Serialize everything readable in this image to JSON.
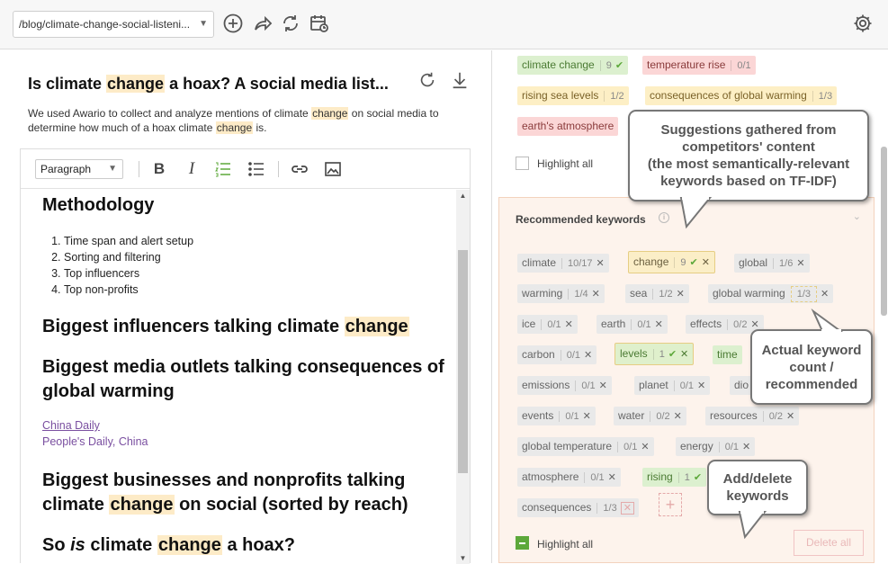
{
  "topbar": {
    "url": "/blog/climate-change-social-listeni..."
  },
  "document": {
    "title_pre": "Is climate ",
    "title_hl": "change",
    "title_post": " a hoax? A social media list...",
    "desc_1": "We used Awario to collect and analyze mentions of climate ",
    "desc_hl1": "change",
    "desc_2": " on social media to determine how much of a hoax climate ",
    "desc_hl2": "change",
    "desc_3": " is."
  },
  "editor": {
    "format": "Paragraph",
    "methodology": "Methodology",
    "list": [
      "Time span and alert setup",
      "Sorting and filtering",
      "Top influencers",
      "Top non-profits"
    ],
    "h_influencers_pre": "Biggest influencers talking climate ",
    "h_influencers_hl": "change",
    "h_media_1": "Biggest media outlets talking consequences of",
    "h_media_2": "global warming",
    "link_1": "China Daily",
    "link_2": "People's Daily, China",
    "h_business_1": "Biggest businesses and nonprofits talking",
    "h_business_2_pre": "climate ",
    "h_business_2_hl": "change",
    "h_business_2_post": " on social (sorted by reach)",
    "h_hoax_pre": "So ",
    "h_hoax_em": "is",
    "h_hoax_mid": " climate ",
    "h_hoax_hl": "change",
    "h_hoax_post": " a hoax?"
  },
  "top_keywords": [
    {
      "label": "climate change",
      "count": "9",
      "state": "green"
    },
    {
      "label": "temperature rise",
      "count": "0/1",
      "state": "red"
    },
    {
      "label": "rising sea levels",
      "count": "1/2",
      "state": "yellow"
    },
    {
      "label": "consequences of global warming",
      "count": "1/3",
      "state": "yellow"
    },
    {
      "label": "earth's atmosphere",
      "count": "",
      "state": "red"
    }
  ],
  "highlight_all_top": "Highlight all",
  "recommended": {
    "title": "Recommended keywords",
    "keywords": [
      {
        "label": "climate",
        "count": "10/17"
      },
      {
        "label": "change",
        "count": "9"
      },
      {
        "label": "global",
        "count": "1/6"
      },
      {
        "label": "warming",
        "count": "1/4"
      },
      {
        "label": "sea",
        "count": "1/2"
      },
      {
        "label": "global warming",
        "count": "1/3"
      },
      {
        "label": "ice",
        "count": "0/1"
      },
      {
        "label": "earth",
        "count": "0/1"
      },
      {
        "label": "effects",
        "count": "0/2"
      },
      {
        "label": "carbon",
        "count": "0/1"
      },
      {
        "label": "levels",
        "count": "1"
      },
      {
        "label": "time",
        "count": ""
      },
      {
        "label": "emissions",
        "count": "0/1"
      },
      {
        "label": "planet",
        "count": "0/1"
      },
      {
        "label": "dio",
        "count": ""
      },
      {
        "label": "events",
        "count": "0/1"
      },
      {
        "label": "water",
        "count": "0/2"
      },
      {
        "label": "resources",
        "count": "0/2"
      },
      {
        "label": "global temperature",
        "count": "0/1"
      },
      {
        "label": "energy",
        "count": "0/1"
      },
      {
        "label": "atmosphere",
        "count": "0/1"
      },
      {
        "label": "rising",
        "count": "1"
      },
      {
        "label": "consequences",
        "count": "1/3"
      }
    ],
    "highlight_all": "Highlight all",
    "delete_all": "Delete all"
  },
  "callouts": {
    "suggestions_1": "Suggestions gathered from",
    "suggestions_2": "competitors' content",
    "suggestions_3": "(the most semantically-relevant",
    "suggestions_4": "keywords based on TF-IDF)",
    "count_1": "Actual keyword",
    "count_2": "count /",
    "count_3": "recommended",
    "add_1": "Add/delete",
    "add_2": "keywords"
  }
}
